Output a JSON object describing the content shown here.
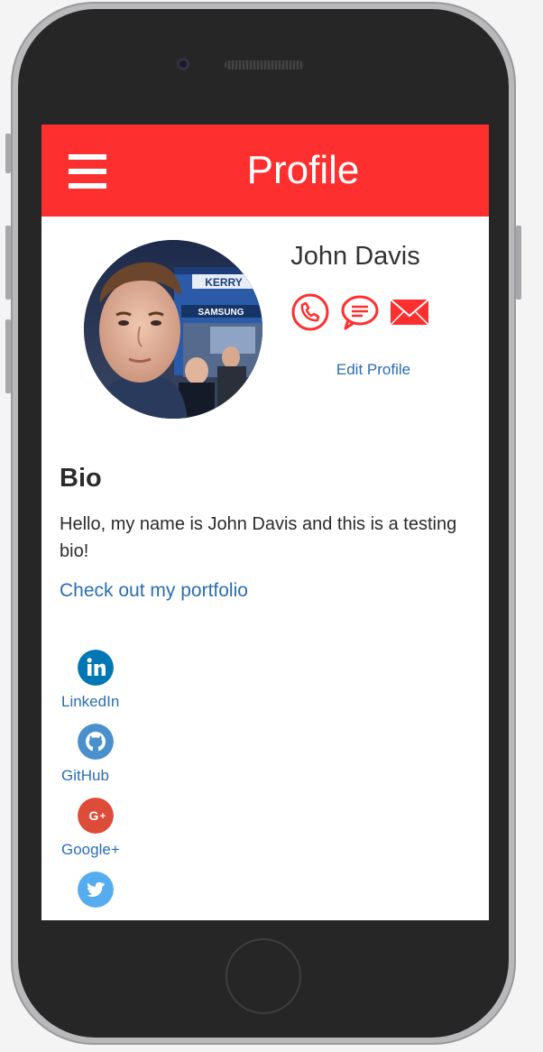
{
  "header": {
    "title": "Profile"
  },
  "profile": {
    "name": "John Davis",
    "edit_label": "Edit Profile",
    "photo_backdrop_text": {
      "sign_top": "KERRY",
      "sign_bottom": "SAMSUNG"
    }
  },
  "contact_icons": [
    "phone-icon",
    "message-icon",
    "email-icon"
  ],
  "bio": {
    "heading": "Bio",
    "text": "Hello, my name is John Davis and this is a testing bio!",
    "portfolio_link": "Check out my portfolio"
  },
  "social": [
    {
      "label": "LinkedIn",
      "icon": "linkedin-icon",
      "color": "#0077b5"
    },
    {
      "label": "GitHub",
      "icon": "github-icon",
      "color": "#4a90cd"
    },
    {
      "label": "Google+",
      "icon": "google-plus-icon",
      "color": "#dd4b39"
    },
    {
      "label": "",
      "icon": "twitter-icon",
      "color": "#55acee"
    }
  ],
  "colors": {
    "header": "#fd2f2f",
    "accent": "#fd2f2f",
    "link": "#2a6eb0"
  }
}
